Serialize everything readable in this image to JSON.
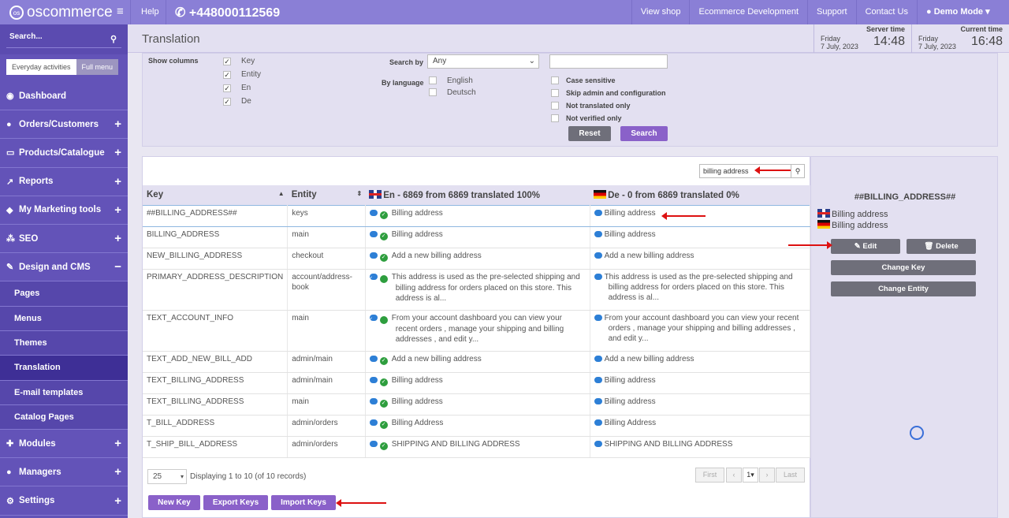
{
  "topbar": {
    "logo": "oscommerce",
    "logo_mark": "os",
    "help": "Help",
    "phone": "+448000112569",
    "nav": [
      "View shop",
      "Ecommerce Development",
      "Support",
      "Contact Us"
    ],
    "user": "Demo Mode"
  },
  "sidebar": {
    "search_placeholder": "Search...",
    "mode": [
      "Everyday activities",
      "Full menu"
    ],
    "items": [
      {
        "label": "Dashboard",
        "icon": "dashboard-icon"
      },
      {
        "label": "Orders/Customers",
        "icon": "users-icon"
      },
      {
        "label": "Products/Catalogue",
        "icon": "folder-icon"
      },
      {
        "label": "Reports",
        "icon": "chart-icon"
      },
      {
        "label": "My Marketing tools",
        "icon": "tag-icon"
      },
      {
        "label": "SEO",
        "icon": "sitemap-icon"
      },
      {
        "label": "Design and CMS",
        "icon": "pencil-icon"
      }
    ],
    "subitems": [
      "Pages",
      "Menus",
      "Themes",
      "Translation",
      "E-mail templates",
      "Catalog Pages"
    ],
    "items_after": [
      {
        "label": "Modules",
        "icon": "puzzle-icon"
      },
      {
        "label": "Managers",
        "icon": "user-icon"
      },
      {
        "label": "Settings",
        "icon": "cogs-icon"
      }
    ]
  },
  "header": {
    "title": "Translation",
    "server_label": "Server time",
    "server_day": "Friday",
    "server_date": "7 July, 2023",
    "server_time": "14:48",
    "current_label": "Current time",
    "current_day": "Friday",
    "current_date": "7 July, 2023",
    "current_time": "16:48"
  },
  "filter": {
    "show_columns_label": "Show columns",
    "columns": [
      "Key",
      "Entity",
      "En",
      "De"
    ],
    "search_by_label": "Search by",
    "search_by_value": "Any",
    "by_language_label": "By language",
    "languages": [
      "English",
      "Deutsch"
    ],
    "options": [
      "Case sensitive",
      "Skip admin and configuration",
      "Not translated only",
      "Not verified only"
    ],
    "reset": "Reset",
    "search": "Search"
  },
  "table": {
    "search_value": "billing address",
    "headers": [
      "Key",
      "Entity",
      "En - 6869 from 6869 translated 100%",
      "De - 0 from 6869 translated 0%"
    ],
    "rows": [
      {
        "key": "##BILLING_ADDRESS##",
        "entity": "keys",
        "en": "Billing address",
        "de": "Billing address"
      },
      {
        "key": "BILLING_ADDRESS",
        "entity": "main",
        "en": "Billing address",
        "de": "Billing address"
      },
      {
        "key": "NEW_BILLING_ADDRESS",
        "entity": "checkout",
        "en": "Add a new billing address",
        "de": "Add a new billing address"
      },
      {
        "key": "PRIMARY_ADDRESS_DESCRIPTION",
        "entity": "account/address-book",
        "en": "This address is used as the pre-selected shipping and billing address for orders placed on this store. This address is al...",
        "de": "This address is used as the pre-selected shipping and billing address for orders placed on this store. This address is al..."
      },
      {
        "key": "TEXT_ACCOUNT_INFO",
        "entity": "main",
        "en": "From your account dashboard you can view your recent orders , manage your shipping and billing addresses , and edit y...",
        "de": "From your account dashboard you can view your recent orders , manage your shipping and billing addresses , and edit y..."
      },
      {
        "key": "TEXT_ADD_NEW_BILL_ADD",
        "entity": "admin/main",
        "en": "Add a new billing address",
        "de": "Add a new billing address"
      },
      {
        "key": "TEXT_BILLING_ADDRESS",
        "entity": "admin/main",
        "en": "Billing address",
        "de": "Billing address"
      },
      {
        "key": "TEXT_BILLING_ADDRESS",
        "entity": "main",
        "en": "Billing address",
        "de": "Billing address"
      },
      {
        "key": "T_BILL_ADDRESS",
        "entity": "admin/orders",
        "en": "Billing Address",
        "de": "Billing Address"
      },
      {
        "key": "T_SHIP_BILL_ADDRESS",
        "entity": "admin/orders",
        "en": "SHIPPING AND BILLING ADDRESS",
        "de": "SHIPPING AND BILLING ADDRESS"
      }
    ],
    "per_page": "25",
    "displaying": "Displaying 1 to 10 (of 10 records)",
    "pagination": {
      "first": "First",
      "page": "1",
      "last": "Last"
    },
    "actions": [
      "New Key",
      "Export Keys",
      "Import Keys"
    ]
  },
  "details": {
    "title": "##BILLING_ADDRESS##",
    "en": "Billing address",
    "de": "Billing address",
    "edit": "Edit",
    "delete": "Delete",
    "change_key": "Change Key",
    "change_entity": "Change Entity"
  }
}
